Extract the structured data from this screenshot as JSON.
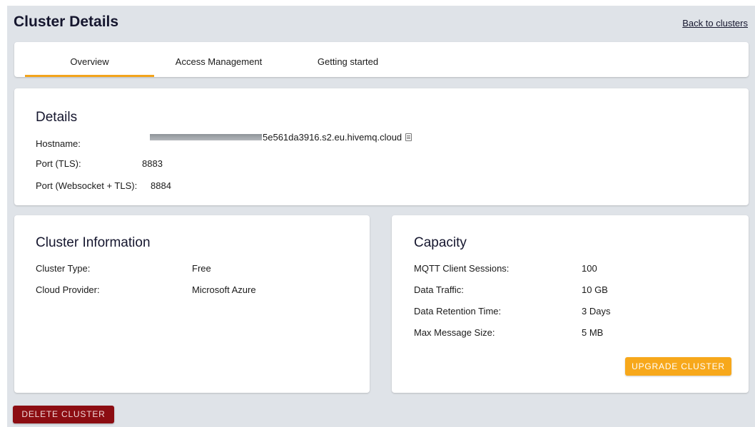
{
  "header": {
    "title": "Cluster Details",
    "back_link": "Back to clusters"
  },
  "tabs": [
    {
      "label": "Overview",
      "active": true
    },
    {
      "label": "Access Management",
      "active": false
    },
    {
      "label": "Getting started",
      "active": false
    }
  ],
  "details": {
    "title": "Details",
    "rows": [
      {
        "label": "Hostname:",
        "value": "5e561da3916.s2.eu.hivemq.cloud"
      },
      {
        "label": "Port (TLS):",
        "value": "8883"
      },
      {
        "label": "Port (Websocket + TLS):",
        "value": "8884"
      }
    ],
    "copy_icon": "clipboard-icon"
  },
  "cluster_info": {
    "title": "Cluster Information",
    "rows": [
      {
        "label": "Cluster Type:",
        "value": "Free"
      },
      {
        "label": "Cloud Provider:",
        "value": "Microsoft Azure"
      }
    ]
  },
  "capacity": {
    "title": "Capacity",
    "rows": [
      {
        "label": "MQTT Client Sessions:",
        "value": "100"
      },
      {
        "label": "Data Traffic:",
        "value": "10 GB"
      },
      {
        "label": "Data Retention Time:",
        "value": "3 Days"
      },
      {
        "label": "Max Message Size:",
        "value": "5 MB"
      }
    ],
    "upgrade_label": "UPGRADE CLUSTER"
  },
  "actions": {
    "delete_label": "DELETE CLUSTER"
  },
  "colors": {
    "accent": "#f7a81b",
    "danger": "#8c0d12",
    "background": "#dfe3e8"
  }
}
